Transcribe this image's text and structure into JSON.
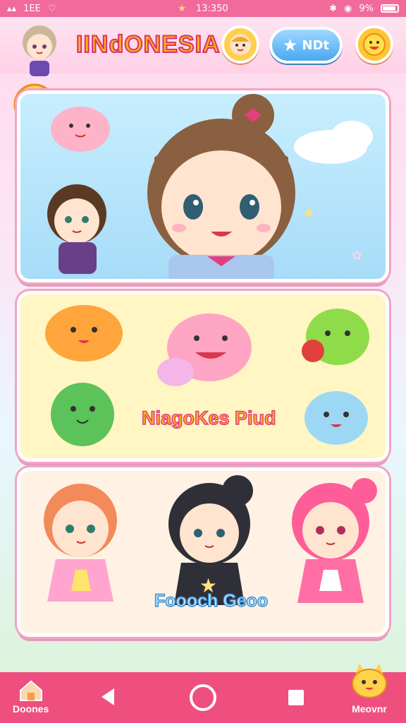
{
  "status_bar": {
    "left_text": "1EE",
    "time": "13:350",
    "battery": "9%"
  },
  "header": {
    "title": "IINdONESIA",
    "badge_label": "NDt"
  },
  "panels": {
    "creatures_caption": "NiagoKes Piud",
    "characters_caption": "Foooch Geoo"
  },
  "nav": {
    "home_label": "Doones",
    "mascot_label": "Meovnr"
  },
  "colors": {
    "accent": "#ee4f7e",
    "header_title": "#ffb31a",
    "nav_bg": "#ee4f7e"
  }
}
